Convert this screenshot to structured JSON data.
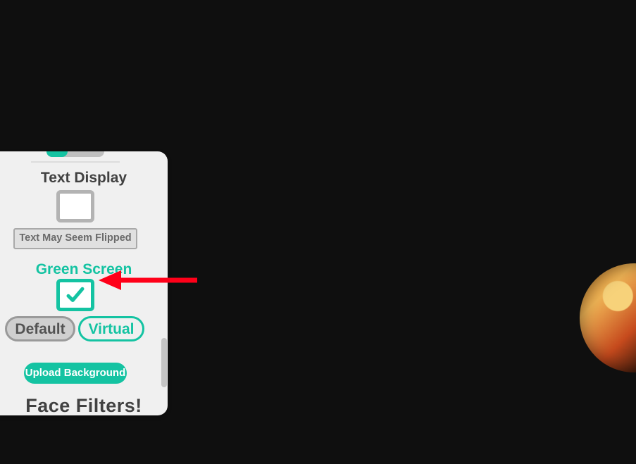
{
  "panel": {
    "text_display": {
      "title": "Text Display",
      "flip_note": "Text May Seem Flipped"
    },
    "green_screen": {
      "title": "Green Screen",
      "checked": true
    },
    "mode": {
      "default_label": "Default",
      "virtual_label": "Virtual"
    },
    "upload_label": "Upload Background",
    "face_filters_title": "Face Filters!"
  },
  "colors": {
    "accent": "#14c3a2",
    "arrow": "#ff0019"
  }
}
